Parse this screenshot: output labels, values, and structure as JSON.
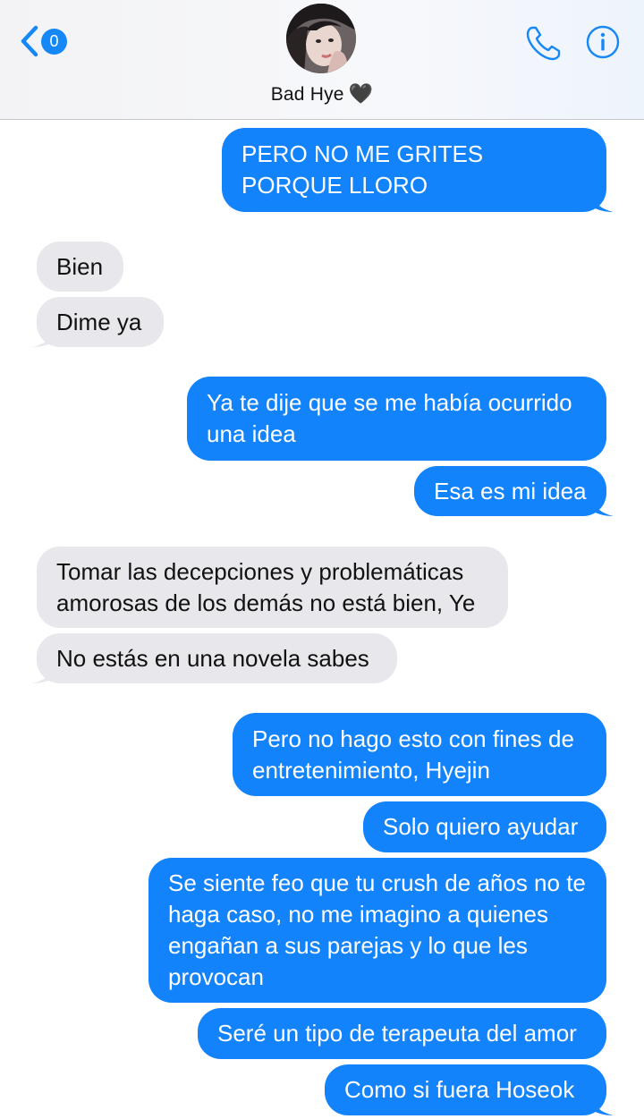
{
  "header": {
    "back_count": "0",
    "contact_name": "Bad Hye",
    "contact_emoji": "🖤"
  },
  "colors": {
    "sent_bubble": "#1283fa",
    "received_bubble": "#e8e8ec",
    "accent": "#1687f7"
  },
  "messages": [
    {
      "from": "me",
      "text": "PERO NO ME GRITES PORQUE LLORO"
    },
    {
      "from": "them",
      "text": "Bien"
    },
    {
      "from": "them",
      "text": "Dime ya"
    },
    {
      "from": "me",
      "text": "Ya te dije que se me había ocurrido una idea"
    },
    {
      "from": "me",
      "text": "Esa es mi idea"
    },
    {
      "from": "them",
      "text": "Tomar las decepciones y problemáticas amorosas de los demás no está bien, Ye"
    },
    {
      "from": "them",
      "text": "No estás en una novela sabes"
    },
    {
      "from": "me",
      "text": "Pero no hago esto con fines de entretenimiento, Hyejin"
    },
    {
      "from": "me",
      "text": "Solo quiero ayudar"
    },
    {
      "from": "me",
      "text": "Se siente feo que tu crush de años no te haga caso, no me imagino a quienes engañan a sus parejas y lo que les provocan"
    },
    {
      "from": "me",
      "text": "Seré un tipo de terapeuta del amor"
    },
    {
      "from": "me",
      "text": "Como si fuera Hoseok"
    }
  ]
}
